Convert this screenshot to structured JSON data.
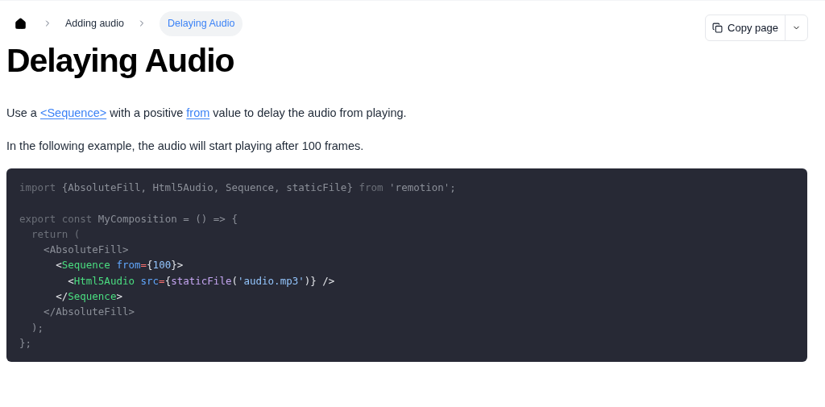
{
  "breadcrumbs": [
    {
      "kind": "home",
      "selected": false
    },
    {
      "kind": "text",
      "label": "Adding audio",
      "selected": false
    },
    {
      "kind": "text",
      "label": "Delaying Audio",
      "selected": true
    }
  ],
  "copy_button": {
    "label": "Copy page"
  },
  "title": "Delaying Audio",
  "paragraphs": [
    [
      {
        "kind": "text",
        "text": "Use a "
      },
      {
        "kind": "link",
        "text": "<Sequence>"
      },
      {
        "kind": "text",
        "text": " with a positive "
      },
      {
        "kind": "link",
        "text": "from"
      },
      {
        "kind": "text",
        "text": " value to delay the audio from playing."
      }
    ],
    [
      {
        "kind": "text",
        "text": "In the following example, the audio will start playing after 100 frames."
      }
    ]
  ],
  "code": [
    {
      "kind": "code",
      "focused": false,
      "tokens": [
        {
          "kind": "kw",
          "text": "import "
        },
        {
          "kind": "plain",
          "text": "{AbsoluteFill, Html5Audio, Sequence, staticFile} "
        },
        {
          "kind": "kw",
          "text": "from "
        },
        {
          "kind": "plain",
          "text": "'remotion';"
        }
      ]
    },
    {
      "kind": "blank"
    },
    {
      "kind": "code",
      "focused": false,
      "tokens": [
        {
          "kind": "kw",
          "text": "export const "
        },
        {
          "kind": "plain",
          "text": "MyComposition = () => {"
        }
      ]
    },
    {
      "kind": "code",
      "focused": false,
      "tokens": [
        {
          "kind": "kw",
          "text": "  return ("
        }
      ]
    },
    {
      "kind": "code",
      "focused": false,
      "tokens": [
        {
          "kind": "plain",
          "text": "    <AbsoluteFill>"
        }
      ]
    },
    {
      "kind": "code",
      "focused": true,
      "tokens": [
        {
          "kind": "plain",
          "text": "      <"
        },
        {
          "kind": "tag",
          "text": "Sequence"
        },
        {
          "kind": "attr",
          "text": " from"
        },
        {
          "kind": "op",
          "text": "="
        },
        {
          "kind": "plain",
          "text": "{"
        },
        {
          "kind": "num",
          "text": "100"
        },
        {
          "kind": "plain",
          "text": "}>"
        }
      ]
    },
    {
      "kind": "code",
      "focused": true,
      "tokens": [
        {
          "kind": "plain",
          "text": "        <"
        },
        {
          "kind": "tag",
          "text": "Html5Audio"
        },
        {
          "kind": "attr",
          "text": " src"
        },
        {
          "kind": "op",
          "text": "="
        },
        {
          "kind": "plain",
          "text": "{"
        },
        {
          "kind": "fn",
          "text": "staticFile"
        },
        {
          "kind": "plain",
          "text": "("
        },
        {
          "kind": "str",
          "text": "'audio.mp3'"
        },
        {
          "kind": "plain",
          "text": ")} />"
        }
      ]
    },
    {
      "kind": "code",
      "focused": true,
      "tokens": [
        {
          "kind": "plain",
          "text": "      </"
        },
        {
          "kind": "tag",
          "text": "Sequence"
        },
        {
          "kind": "plain",
          "text": ">"
        }
      ]
    },
    {
      "kind": "code",
      "focused": false,
      "tokens": [
        {
          "kind": "plain",
          "text": "    </AbsoluteFill>"
        }
      ]
    },
    {
      "kind": "code",
      "focused": false,
      "tokens": [
        {
          "kind": "plain",
          "text": "  );"
        }
      ]
    },
    {
      "kind": "code",
      "focused": false,
      "tokens": [
        {
          "kind": "plain",
          "text": "};"
        }
      ]
    }
  ]
}
